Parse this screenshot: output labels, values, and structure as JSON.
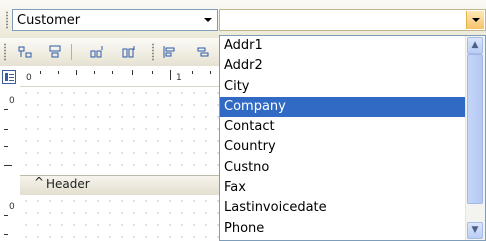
{
  "object_combo": {
    "value": "Customer"
  },
  "field_combo": {
    "value": ""
  },
  "field_list": {
    "items": [
      "Addr1",
      "Addr2",
      "City",
      "Company",
      "Contact",
      "Country",
      "Custno",
      "Fax",
      "Lastinvoicedate",
      "Phone"
    ],
    "selected": "Company"
  },
  "ruler": {
    "h_labels": [
      "0",
      "1"
    ],
    "v_labels": [
      "0",
      "0"
    ]
  },
  "band": {
    "header_label": "Header"
  },
  "colors": {
    "selection": "#316ac5",
    "toolbar": "#ece9d8",
    "dropdown_accent": "#f6c36a"
  }
}
